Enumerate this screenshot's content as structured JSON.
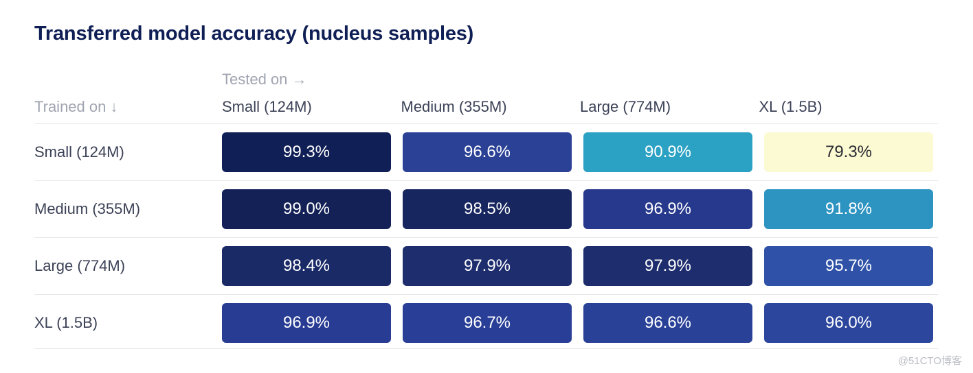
{
  "title": "Transferred model accuracy (nucleus samples)",
  "axis_labels": {
    "columns": "Tested on →",
    "rows": "Trained on ↓"
  },
  "watermark": "@51CTO博客",
  "colors": {
    "title": "#0f1f55",
    "axis_label": "#a0a4b0",
    "header": "#3c4257",
    "divider": "#e6e8ec",
    "background": "#ffffff"
  },
  "chart_data": {
    "type": "heatmap",
    "title": "Transferred model accuracy (nucleus samples)",
    "xlabel": "Tested on →",
    "ylabel": "Trained on ↓",
    "categories": [
      "Small (124M)",
      "Medium (355M)",
      "Large (774M)",
      "XL (1.5B)"
    ],
    "row_categories": [
      "Small (124M)",
      "Medium (355M)",
      "Large (774M)",
      "XL (1.5B)"
    ],
    "unit": "%",
    "value_range": [
      79.3,
      99.3
    ],
    "grid": false,
    "legend": "none",
    "rows": [
      {
        "label": "Small (124M)",
        "cells": [
          {
            "value": "99.3%",
            "bg": "#101f55",
            "fg": "#ffffff"
          },
          {
            "value": "96.6%",
            "bg": "#2a4195",
            "fg": "#ffffff"
          },
          {
            "value": "90.9%",
            "bg": "#2ba1c4",
            "fg": "#ffffff"
          },
          {
            "value": "79.3%",
            "bg": "#fcfad3",
            "fg": "#2b2b33"
          }
        ]
      },
      {
        "label": "Medium (355M)",
        "cells": [
          {
            "value": "99.0%",
            "bg": "#132157",
            "fg": "#ffffff"
          },
          {
            "value": "98.5%",
            "bg": "#17265e",
            "fg": "#ffffff"
          },
          {
            "value": "96.9%",
            "bg": "#27398c",
            "fg": "#ffffff"
          },
          {
            "value": "91.8%",
            "bg": "#2d93c0",
            "fg": "#ffffff"
          }
        ]
      },
      {
        "label": "Large (774M)",
        "cells": [
          {
            "value": "98.4%",
            "bg": "#1a2a67",
            "fg": "#ffffff"
          },
          {
            "value": "97.9%",
            "bg": "#1d2d6e",
            "fg": "#ffffff"
          },
          {
            "value": "97.9%",
            "bg": "#1d2d6e",
            "fg": "#ffffff"
          },
          {
            "value": "95.7%",
            "bg": "#2f52a8",
            "fg": "#ffffff"
          }
        ]
      },
      {
        "label": "XL (1.5B)",
        "cells": [
          {
            "value": "96.9%",
            "bg": "#283c93",
            "fg": "#ffffff"
          },
          {
            "value": "96.7%",
            "bg": "#293e96",
            "fg": "#ffffff"
          },
          {
            "value": "96.6%",
            "bg": "#2a4198",
            "fg": "#ffffff"
          },
          {
            "value": "96.0%",
            "bg": "#2c469e",
            "fg": "#ffffff"
          }
        ]
      }
    ]
  }
}
